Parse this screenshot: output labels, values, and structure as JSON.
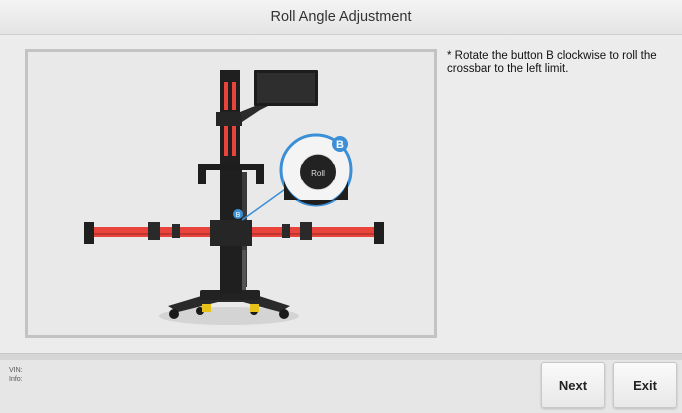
{
  "header": {
    "title": "Roll Angle Adjustment"
  },
  "instruction": {
    "text": "* Rotate the button B clockwise to roll the crossbar to the left limit."
  },
  "illustration": {
    "callout_letter": "B",
    "roll_label": "Roll",
    "small_marker": "B",
    "accent_color": "#e8443c",
    "callout_color": "#3a8fd6"
  },
  "footer": {
    "vin_label": "VIN:",
    "info_label": "Info:",
    "next_label": "Next",
    "exit_label": "Exit"
  }
}
